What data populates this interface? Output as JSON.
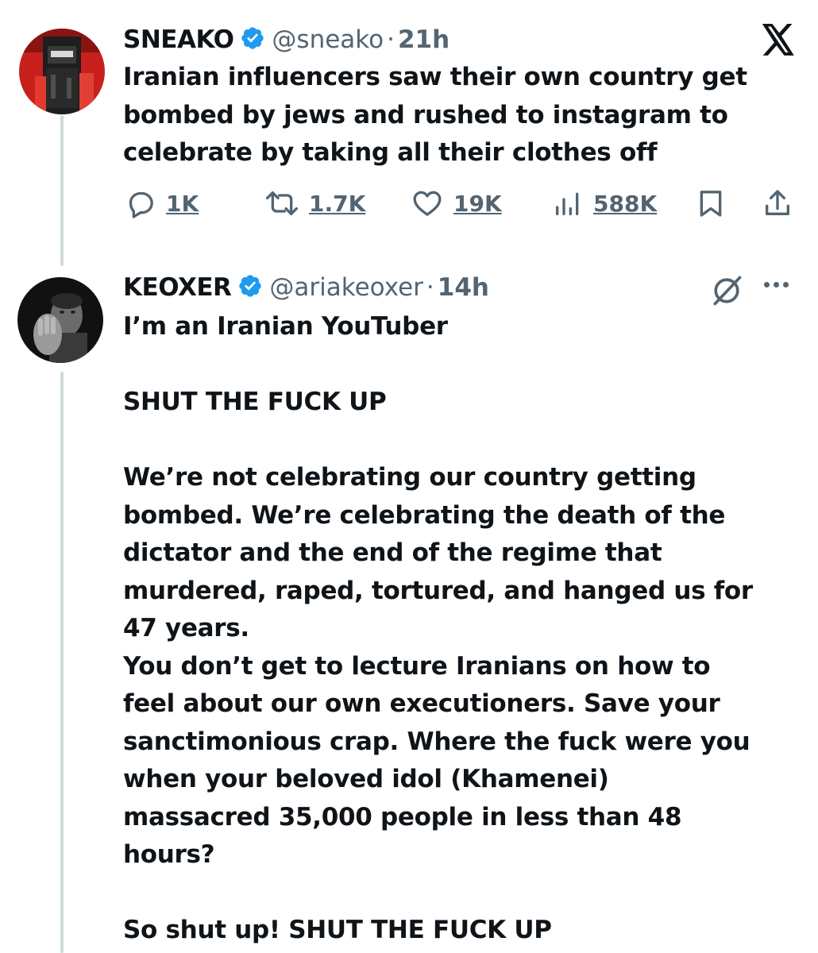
{
  "tweet1": {
    "name": "SNEAKO",
    "handle": "@sneako",
    "separator": "·",
    "time": "21h",
    "text": "Iranian influencers saw their own country get\nbombed by jews and rushed to instagram to\ncelebrate by taking all their clothes off",
    "actions": {
      "replies": "1K",
      "reposts": "1.7K",
      "likes": "19K",
      "views": "588K"
    },
    "icons": [
      "x-logo-icon",
      "reply-icon",
      "repost-icon",
      "like-icon",
      "views-icon",
      "bookmark-icon",
      "share-icon"
    ]
  },
  "tweet2": {
    "name": "KEOXER",
    "handle": "@ariakeoxer",
    "separator": "·",
    "time": "14h",
    "text": "I’m an Iranian YouTuber\n\nSHUT THE FUCK UP\n\nWe’re not celebrating our country getting\nbombed. We’re celebrating the death of the\ndictator and the end of the regime that\nmurdered, raped, tortured, and hanged us for\n47 years.\nYou don’t get to lecture Iranians on how to\nfeel about our own executioners. Save your\nsanctimonious crap. Where the fuck were you\nwhen your beloved idol (Khamenei)\nmassacred 35,000 people in less than 48\nhours?\n\nSo shut up! SHUT THE FUCK UP",
    "icons": [
      "grok-icon",
      "more-icon"
    ]
  },
  "colors": {
    "verified": "#1d9bf0",
    "secondary_text": "#536471",
    "thread_line": "#cfd9de",
    "text": "#0f1419"
  }
}
